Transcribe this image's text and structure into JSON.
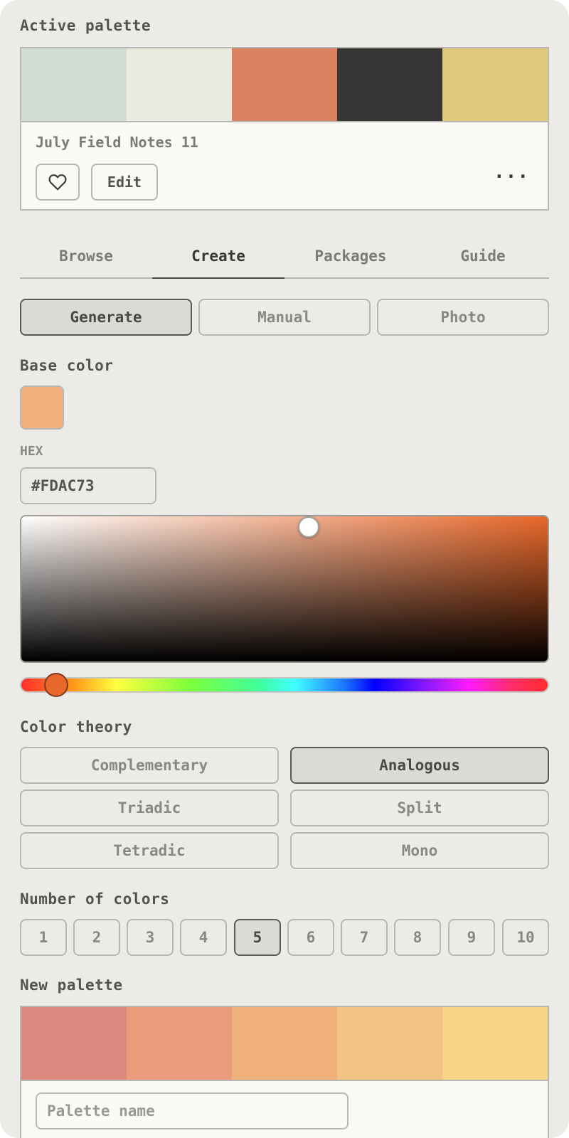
{
  "active_palette": {
    "heading": "Active palette",
    "colors": [
      "#d3dbd5",
      "#eaeadf",
      "#d9825f",
      "#363634",
      "#e3c97e"
    ],
    "name": "July Field Notes 11",
    "edit_label": "Edit",
    "like_icon": "heart-icon",
    "more_icon": "more-horizontal-icon",
    "more_label": "..."
  },
  "tabs": [
    {
      "label": "Browse",
      "active": false
    },
    {
      "label": "Create",
      "active": true
    },
    {
      "label": "Packages",
      "active": false
    },
    {
      "label": "Guide",
      "active": false
    }
  ],
  "modes": [
    {
      "label": "Generate",
      "active": true
    },
    {
      "label": "Manual",
      "active": false
    },
    {
      "label": "Photo",
      "active": false
    }
  ],
  "base_color": {
    "heading": "Base color",
    "swatch": "#f2b07e",
    "hex_label": "HEX",
    "hex_value": "#FDAC73",
    "hue_color": "#e8672a"
  },
  "color_theory": {
    "heading": "Color theory",
    "options": [
      {
        "label": "Complementary",
        "active": false
      },
      {
        "label": "Analogous",
        "active": true
      },
      {
        "label": "Triadic",
        "active": false
      },
      {
        "label": "Split",
        "active": false
      },
      {
        "label": "Tetradic",
        "active": false
      },
      {
        "label": "Mono",
        "active": false
      }
    ]
  },
  "number_of_colors": {
    "heading": "Number of colors",
    "options": [
      "1",
      "2",
      "3",
      "4",
      "5",
      "6",
      "7",
      "8",
      "9",
      "10"
    ],
    "selected": "5"
  },
  "new_palette": {
    "heading": "New palette",
    "colors": [
      "#db8a80",
      "#e89c7c",
      "#f0b07c",
      "#f3c383",
      "#f6d588"
    ],
    "name_placeholder": "Palette name"
  }
}
